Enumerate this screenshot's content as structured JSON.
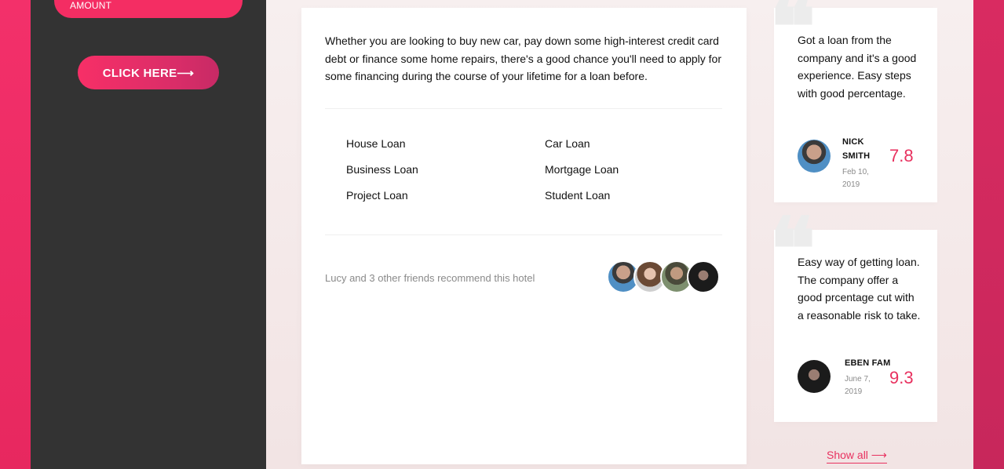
{
  "sidebar": {
    "amount_label": "AMOUNT",
    "cta_label": "CLICK HERE⟶"
  },
  "main": {
    "intro": "Whether you are looking to buy new car, pay down some high-interest credit card debt or finance some home repairs, there's a good chance you'll need to apply for some financing during the course of your lifetime for a loan before.",
    "loan_types": [
      "House Loan",
      "Car Loan",
      "Business Loan",
      "Mortgage Loan",
      "Project Loan",
      "Student Loan"
    ],
    "recommend_text": "Lucy and 3 other friends recommend this hotel"
  },
  "testimonials": [
    {
      "text": "Got a loan from the company and it's a good experience. Easy steps with good percentage.",
      "name": "NICK SMITH",
      "date": "Feb 10, 2019",
      "rating": "7.8"
    },
    {
      "text": "Easy way of getting loan. The company offer a good prcentage cut with a reasonable risk to take.",
      "name": "EBEN FAM",
      "date": "June 7, 2019",
      "rating": "9.3"
    }
  ],
  "show_all_label": "Show all ⟶",
  "colors": {
    "accent": "#e8315f",
    "sidebar_bg": "#333333",
    "content_bg": "#f5ebeb"
  }
}
